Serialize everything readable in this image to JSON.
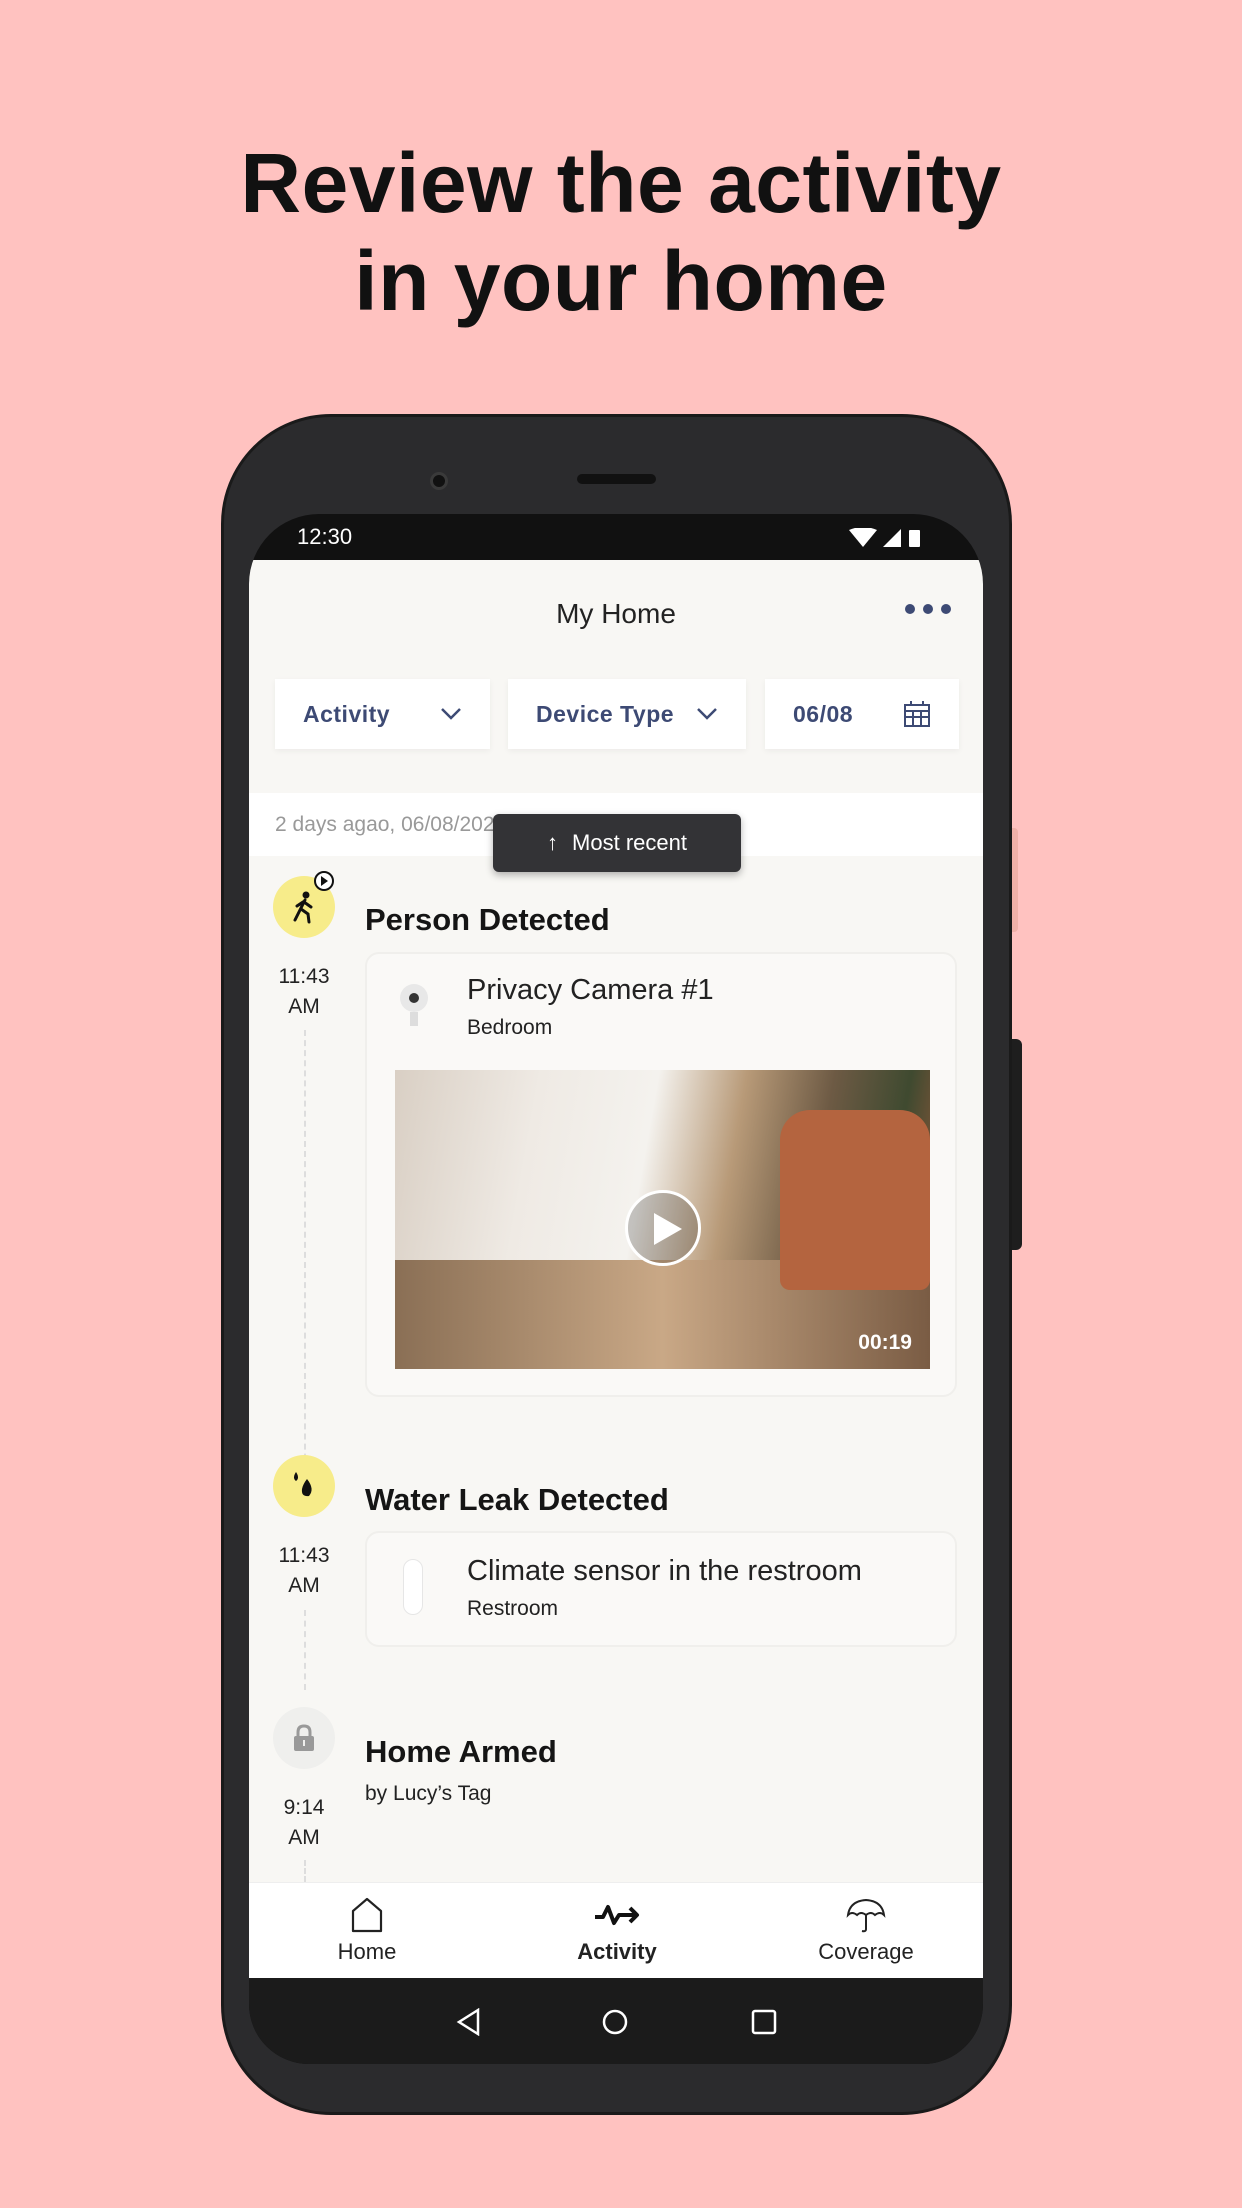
{
  "headline": {
    "line1": "Review the activity",
    "line2": "in your home"
  },
  "status_bar": {
    "time": "12:30",
    "icons": [
      "wifi-icon",
      "signal-icon",
      "battery-icon"
    ]
  },
  "header": {
    "title": "My Home",
    "menu_icon": "more-horizontal-icon"
  },
  "filters": [
    {
      "label": "Activity",
      "icon": "chevron-down-icon"
    },
    {
      "label": "Device Type",
      "icon": "chevron-down-icon"
    },
    {
      "label": "06/08",
      "icon": "calendar-icon"
    }
  ],
  "date_header": "2 days agao, 06/08/2020",
  "toast": {
    "label": "Most recent",
    "icon": "arrow-up-icon"
  },
  "events": [
    {
      "title": "Person Detected",
      "time": "11:43",
      "ampm": "AM",
      "icon": "person-walking-icon",
      "icon_color": "#f7ec8a",
      "device": {
        "name": "Privacy Camera #1",
        "room": "Bedroom"
      },
      "video": {
        "duration": "00:19"
      }
    },
    {
      "title": "Water Leak Detected",
      "time": "11:43",
      "ampm": "AM",
      "icon": "water-drops-icon",
      "icon_color": "#f7ec8a",
      "device": {
        "name": "Climate sensor in the restroom",
        "room": "Restroom"
      }
    },
    {
      "title": "Home Armed",
      "subtitle": "by Lucy’s Tag",
      "time": "9:14",
      "ampm": "AM",
      "icon": "lock-icon",
      "icon_color": "#efefed"
    }
  ],
  "bottom_nav": [
    {
      "label": "Home",
      "icon": "home-icon",
      "active": false
    },
    {
      "label": "Activity",
      "icon": "activity-icon",
      "active": true
    },
    {
      "label": "Coverage",
      "icon": "umbrella-icon",
      "active": false
    }
  ],
  "colors": {
    "background": "#ffc2c0",
    "accent": "#3d4a74",
    "event_icon": "#f7ec8a"
  }
}
